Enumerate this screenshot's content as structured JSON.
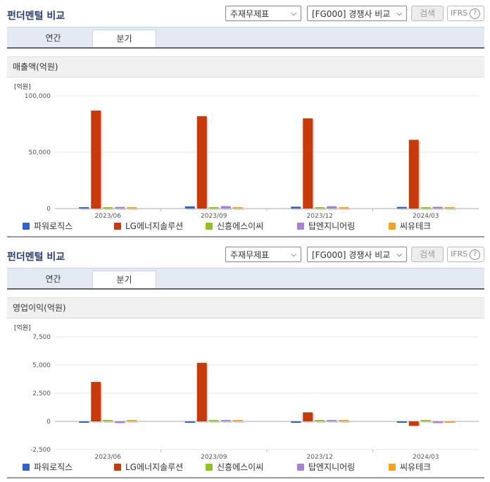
{
  "colors": {
    "series": [
      "#2e62d6",
      "#c83a0a",
      "#8fc31f",
      "#a780d8",
      "#f7a21c"
    ],
    "title": "#2a3f6e",
    "grid": "#e6e6e6"
  },
  "panels": [
    {
      "title": "펀더멘털 비교",
      "select1": "주재무제표",
      "select2": "[FG000] 경쟁사 비교",
      "search_label": "검색",
      "ifrs_label": "IFRS",
      "tabs": [
        "연간",
        "분기"
      ],
      "active_tab": 1,
      "section_label": "매출액(억원)",
      "chart_data": {
        "type": "bar",
        "unit": "[억원]",
        "categories": [
          "2023/06",
          "2023/09",
          "2023/12",
          "2024/03"
        ],
        "ylim": [
          0,
          100000
        ],
        "yticks": [
          0,
          50000,
          100000
        ],
        "ytick_labels": [
          "0",
          "50,000",
          "100,000"
        ],
        "series": [
          {
            "name": "파워로직스",
            "values": [
              1000,
              2000,
              1700,
              1500
            ]
          },
          {
            "name": "LG에너지솔루션",
            "values": [
              87000,
              82000,
              80000,
              61000
            ]
          },
          {
            "name": "신흥에스이씨",
            "values": [
              800,
              900,
              800,
              800
            ]
          },
          {
            "name": "탑엔지니어링",
            "values": [
              1500,
              2200,
              2100,
              1600
            ]
          },
          {
            "name": "씨유테크",
            "values": [
              400,
              300,
              300,
              300
            ]
          }
        ]
      }
    },
    {
      "title": "펀더멘털 비교",
      "select1": "주재무제표",
      "select2": "[FG000] 경쟁사 비교",
      "search_label": "검색",
      "ifrs_label": "IFRS",
      "tabs": [
        "연간",
        "분기"
      ],
      "active_tab": 1,
      "section_label": "영업이익(억원)",
      "chart_data": {
        "type": "bar",
        "unit": "[억원]",
        "categories": [
          "2023/06",
          "2023/09",
          "2023/12",
          "2024/03"
        ],
        "ylim": [
          -2500,
          7500
        ],
        "yticks": [
          -2500,
          0,
          2500,
          5000,
          7500
        ],
        "ytick_labels": [
          "-2,500",
          "0",
          "2,500",
          "5,000",
          "7,500"
        ],
        "series": [
          {
            "name": "파워로직스",
            "values": [
              -50,
              -80,
              -20,
              -60
            ]
          },
          {
            "name": "LG에너지솔루션",
            "values": [
              3500,
              5200,
              800,
              -400
            ]
          },
          {
            "name": "신흥에스이씨",
            "values": [
              80,
              100,
              80,
              60
            ]
          },
          {
            "name": "탑엔지니어링",
            "values": [
              -150,
              20,
              90,
              -150
            ]
          },
          {
            "name": "씨유테크",
            "values": [
              10,
              5,
              5,
              -120
            ]
          }
        ]
      }
    }
  ]
}
